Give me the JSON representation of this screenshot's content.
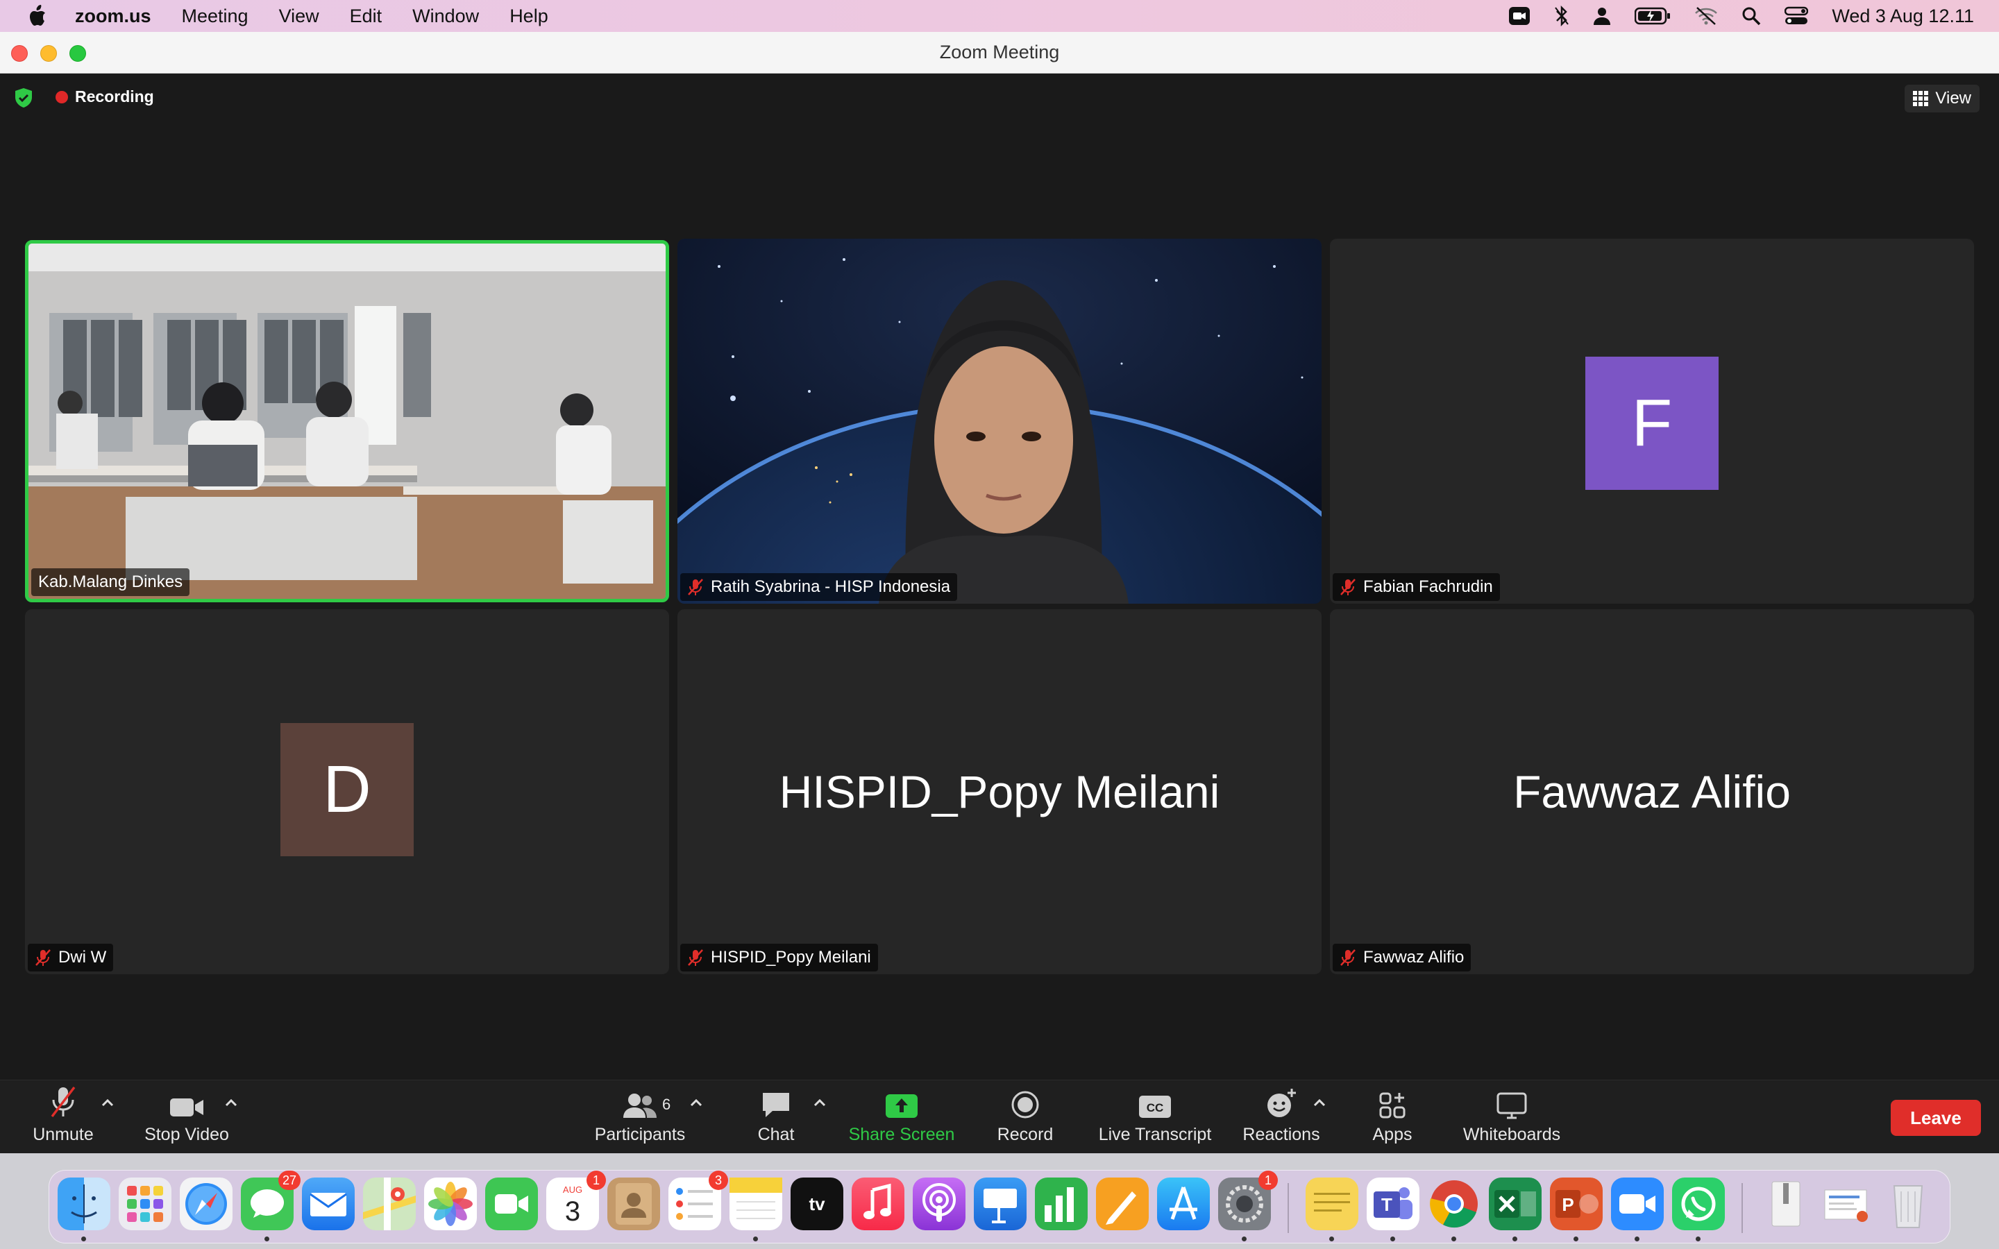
{
  "menubar": {
    "app_name": "zoom.us",
    "items": [
      "Meeting",
      "View",
      "Edit",
      "Window",
      "Help"
    ],
    "clock": "Wed 3 Aug  12.11"
  },
  "window": {
    "title": "Zoom Meeting"
  },
  "meeting": {
    "recording_label": "Recording",
    "view_label": "View",
    "participants": [
      {
        "name": "Kab.Malang Dinkes",
        "video": true,
        "active_speaker": true,
        "muted": false
      },
      {
        "name": "Ratih Syabrina - HISP Indonesia",
        "video": true,
        "muted": true
      },
      {
        "name": "Fabian Fachrudin",
        "avatar_letter": "F",
        "avatar_color": "#7c55c5",
        "muted": true
      },
      {
        "name": "Dwi W",
        "avatar_letter": "D",
        "avatar_color": "#5b413a",
        "muted": true
      },
      {
        "name": "HISPID_Popy Meilani",
        "display_name": "HISPID_Popy Meilani",
        "muted": true
      },
      {
        "name": "Fawwaz Alifio",
        "display_name": "Fawwaz Alifio",
        "muted": true
      }
    ]
  },
  "toolbar": {
    "unmute": "Unmute",
    "stop_video": "Stop Video",
    "participants": "Participants",
    "participants_count": "6",
    "chat": "Chat",
    "share_screen": "Share Screen",
    "record": "Record",
    "live_transcript": "Live Transcript",
    "reactions": "Reactions",
    "apps": "Apps",
    "whiteboards": "Whiteboards",
    "leave": "Leave",
    "accent_green": "#2fca46",
    "leave_color": "#e02e2a"
  },
  "dock": {
    "badges": {
      "messages": "27",
      "calendar": "1",
      "reminders": "3",
      "system_settings": "1"
    },
    "calendar_month": "AUG",
    "calendar_day": "3"
  }
}
